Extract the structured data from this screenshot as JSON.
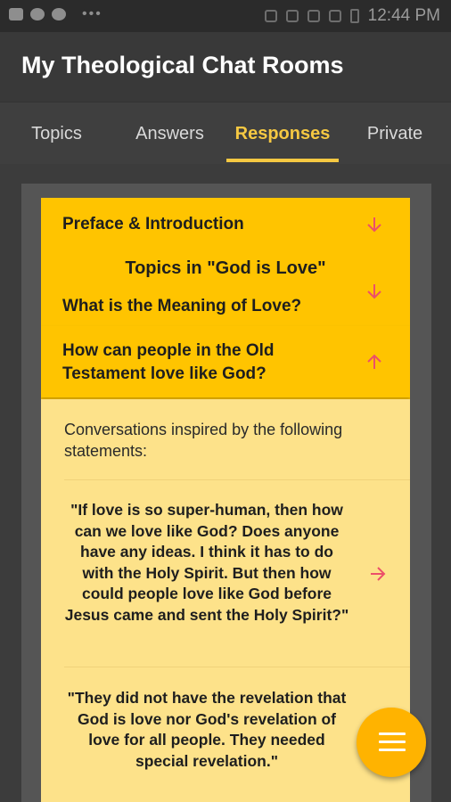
{
  "status_bar": {
    "time": "12:44 PM",
    "left_icons": [
      "image-icon",
      "chat-icon",
      "notification-icon"
    ],
    "right_icons": [
      "bluetooth-icon",
      "mute-icon",
      "wifi-icon",
      "signal-icon",
      "battery-icon"
    ]
  },
  "app_bar": {
    "title": "My Theological Chat Rooms"
  },
  "tabs": [
    {
      "label": "Topics",
      "active": false
    },
    {
      "label": "Answers",
      "active": false
    },
    {
      "label": "Responses",
      "active": true
    },
    {
      "label": "Private",
      "active": false
    }
  ],
  "sections": [
    {
      "label": "Preface & Introduction",
      "arrow": "down"
    },
    {
      "heading": "Topics in \"God is Love\"",
      "label": "What is the Meaning of Love?",
      "arrow": "down"
    },
    {
      "label": "How can people in the Old Testament love like God?",
      "arrow": "up"
    }
  ],
  "expanded_content": {
    "intro": "Conversations inspired by the following statements:",
    "quotes": [
      "\"If love is so super-human, then how can we love like God? Does anyone have any ideas. I think it has to do with the Holy Spirit. But then how could people love like God before Jesus came and sent the Holy Spirit?\"",
      "\"They did not have the revelation that God is love nor God's revelation of love for all people. They needed special revelation.\""
    ]
  },
  "colors": {
    "accent": "#f5c842",
    "card": "#ffc400",
    "card_body": "#fde28a",
    "arrow": "#ec4f6a",
    "fab": "#ffb300"
  },
  "fab": {
    "icon": "menu-icon"
  }
}
